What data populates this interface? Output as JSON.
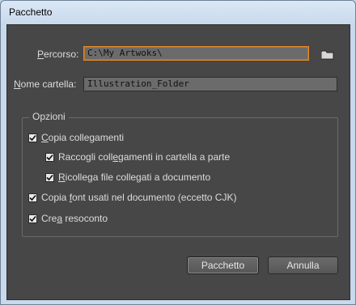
{
  "window": {
    "title": "Pacchetto"
  },
  "percorso": {
    "label_prefix": "",
    "label_u": "P",
    "label_rest": "ercorso:",
    "value": "C:\\My Artwoks\\"
  },
  "nome_cartella": {
    "label_u": "N",
    "label_rest": "ome cartella:",
    "value": "Illustration_Folder"
  },
  "opzioni": {
    "legend": "Opzioni",
    "copia_collegamenti": {
      "label_pre": "",
      "label_u": "C",
      "label_rest": "opia collegamenti",
      "checked": true
    },
    "raccogli": {
      "label_pre": "Raccogli coll",
      "label_u": "e",
      "label_rest": "gamenti in cartella a parte",
      "checked": true
    },
    "ricollega": {
      "label_pre": "",
      "label_u": "R",
      "label_rest": "icollega file collegati a documento",
      "checked": true
    },
    "copia_font": {
      "label_pre": "Copia ",
      "label_u": "f",
      "label_rest": "ont usati nel documento (eccetto CJK)",
      "checked": true
    },
    "crea_resoconto": {
      "label_pre": "Cre",
      "label_u": "a",
      "label_rest": " resoconto",
      "checked": true
    }
  },
  "buttons": {
    "ok": "Pacchetto",
    "cancel": "Annulla"
  },
  "icons": {
    "folder": "folder-icon",
    "checkmark": "checkmark-icon"
  }
}
